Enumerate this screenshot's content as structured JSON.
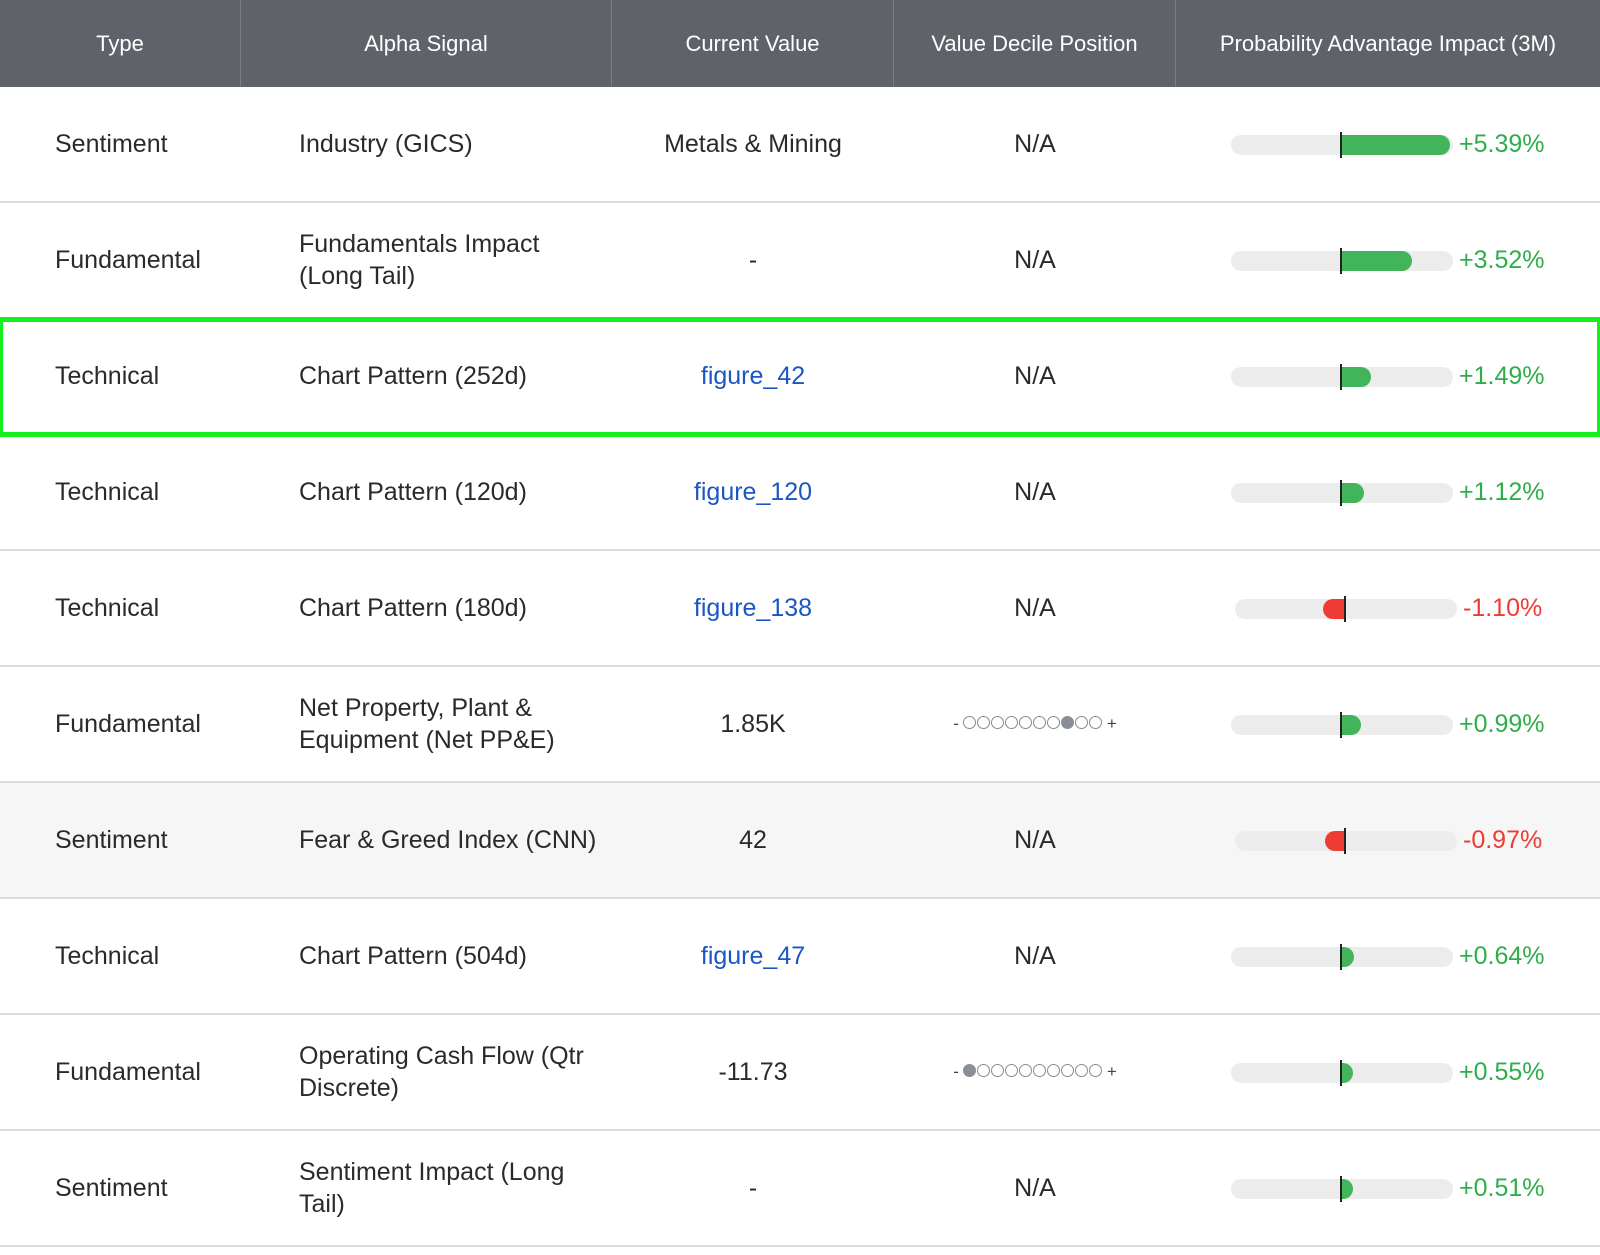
{
  "colors": {
    "header_bg": "#5f6268",
    "positive": "#42b55a",
    "negative": "#ee3b34",
    "link": "#1a56c4",
    "highlight": "#16f01c"
  },
  "header": {
    "type": "Type",
    "signal": "Alpha Signal",
    "value": "Current Value",
    "decile": "Value Decile Position",
    "impact": "Probability Advantage Impact (3M)"
  },
  "rows": [
    {
      "type": "Sentiment",
      "signal": "Industry (GICS)",
      "value": "Metals & Mining",
      "value_is_link": false,
      "decile": "N/A",
      "impact": 5.39,
      "impact_label": "+5.39%"
    },
    {
      "type": "Fundamental",
      "signal": "Fundamentals Impact (Long Tail)",
      "value": "-",
      "value_is_link": false,
      "decile": "N/A",
      "impact": 3.52,
      "impact_label": "+3.52%"
    },
    {
      "type": "Technical",
      "signal": "Chart Pattern (252d)",
      "value": "figure_42",
      "value_is_link": true,
      "decile": "N/A",
      "impact": 1.49,
      "impact_label": "+1.49%",
      "highlighted": true
    },
    {
      "type": "Technical",
      "signal": "Chart Pattern (120d)",
      "value": "figure_120",
      "value_is_link": true,
      "decile": "N/A",
      "impact": 1.12,
      "impact_label": "+1.12%"
    },
    {
      "type": "Technical",
      "signal": "Chart Pattern (180d)",
      "value": "figure_138",
      "value_is_link": true,
      "decile": "N/A",
      "impact": -1.1,
      "impact_label": "-1.10%"
    },
    {
      "type": "Fundamental",
      "signal": "Net Property, Plant & Equipment (Net PP&E)",
      "value": "1.85K",
      "value_is_link": false,
      "decile_dots": 8,
      "decile_minus": "-",
      "decile_plus": "+",
      "impact": 0.99,
      "impact_label": "+0.99%"
    },
    {
      "type": "Sentiment",
      "signal": "Fear & Greed Index (CNN)",
      "value": "42",
      "value_is_link": false,
      "decile": "N/A",
      "impact": -0.97,
      "impact_label": "-0.97%"
    },
    {
      "type": "Technical",
      "signal": "Chart Pattern (504d)",
      "value": "figure_47",
      "value_is_link": true,
      "decile": "N/A",
      "impact": 0.64,
      "impact_label": "+0.64%"
    },
    {
      "type": "Fundamental",
      "signal": "Operating Cash Flow (Qtr Discrete)",
      "value": "-11.73",
      "value_is_link": false,
      "decile_dots": 1,
      "decile_minus": "-",
      "decile_plus": "+",
      "impact": 0.55,
      "impact_label": "+0.55%"
    },
    {
      "type": "Sentiment",
      "signal": "Sentiment Impact (Long Tail)",
      "value": "-",
      "value_is_link": false,
      "decile": "N/A",
      "impact": 0.51,
      "impact_label": "+0.51%"
    }
  ]
}
